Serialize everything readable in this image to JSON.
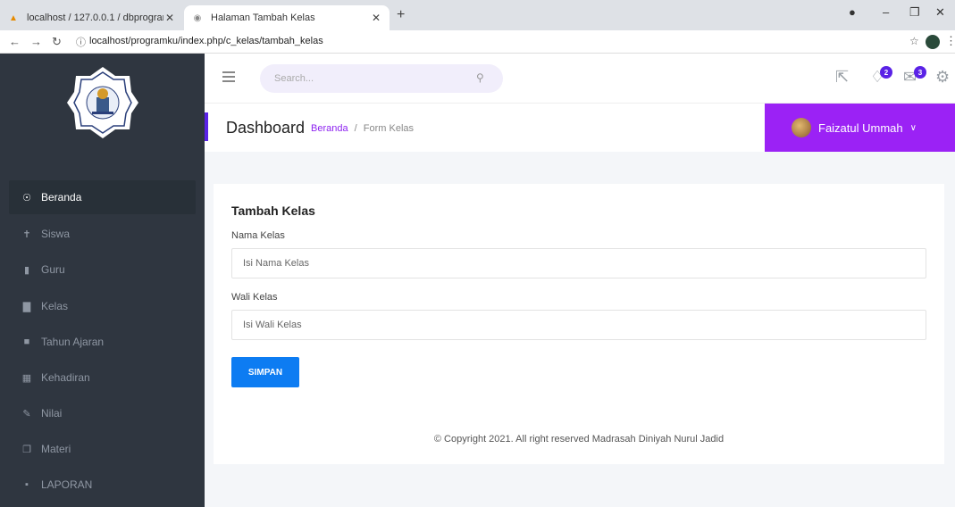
{
  "browser": {
    "tabs": [
      {
        "title": "localhost / 127.0.0.1 / dbprogram",
        "active": false
      },
      {
        "title": "Halaman Tambah Kelas",
        "active": true
      }
    ],
    "new_tab_icon": "plus-icon",
    "url": "localhost/programku/index.php/c_kelas/tambah_kelas"
  },
  "sidebar": {
    "logo_icon": "madrasah-logo",
    "items": [
      {
        "label": "Beranda",
        "icon": "dashboard-icon",
        "active": true
      },
      {
        "label": "Siswa",
        "icon": "person-icon",
        "active": false
      },
      {
        "label": "Guru",
        "icon": "teacher-icon",
        "active": false
      },
      {
        "label": "Kelas",
        "icon": "book-icon",
        "active": false
      },
      {
        "label": "Tahun Ajaran",
        "icon": "folder-icon",
        "active": false
      },
      {
        "label": "Kehadiran",
        "icon": "table-icon",
        "active": false
      },
      {
        "label": "Nilai",
        "icon": "pencil-icon",
        "active": false
      },
      {
        "label": "Materi",
        "icon": "copy-icon",
        "active": false
      },
      {
        "label": "LAPORAN",
        "icon": "file-icon",
        "active": false
      }
    ]
  },
  "topnav": {
    "search_placeholder": "Search...",
    "notif_badge": "2",
    "mail_badge": "3"
  },
  "header": {
    "title": "Dashboard",
    "breadcrumb_home": "Beranda",
    "breadcrumb_sep": "/",
    "breadcrumb_current": "Form Kelas",
    "user_name": "Faizatul Ummah"
  },
  "form": {
    "title": "Tambah Kelas",
    "nama_label": "Nama Kelas",
    "nama_placeholder": "Isi Nama Kelas",
    "wali_label": "Wali Kelas",
    "wali_placeholder": "Isi Wali Kelas",
    "submit_label": "SIMPAN"
  },
  "footer": {
    "text": "© Copyright 2021. All right reserved Madrasah Diniyah Nurul Jadid"
  },
  "colors": {
    "sidebar_bg": "#2f3640",
    "accent_purple": "#9b22f5",
    "button_blue": "#0d7cf2"
  }
}
